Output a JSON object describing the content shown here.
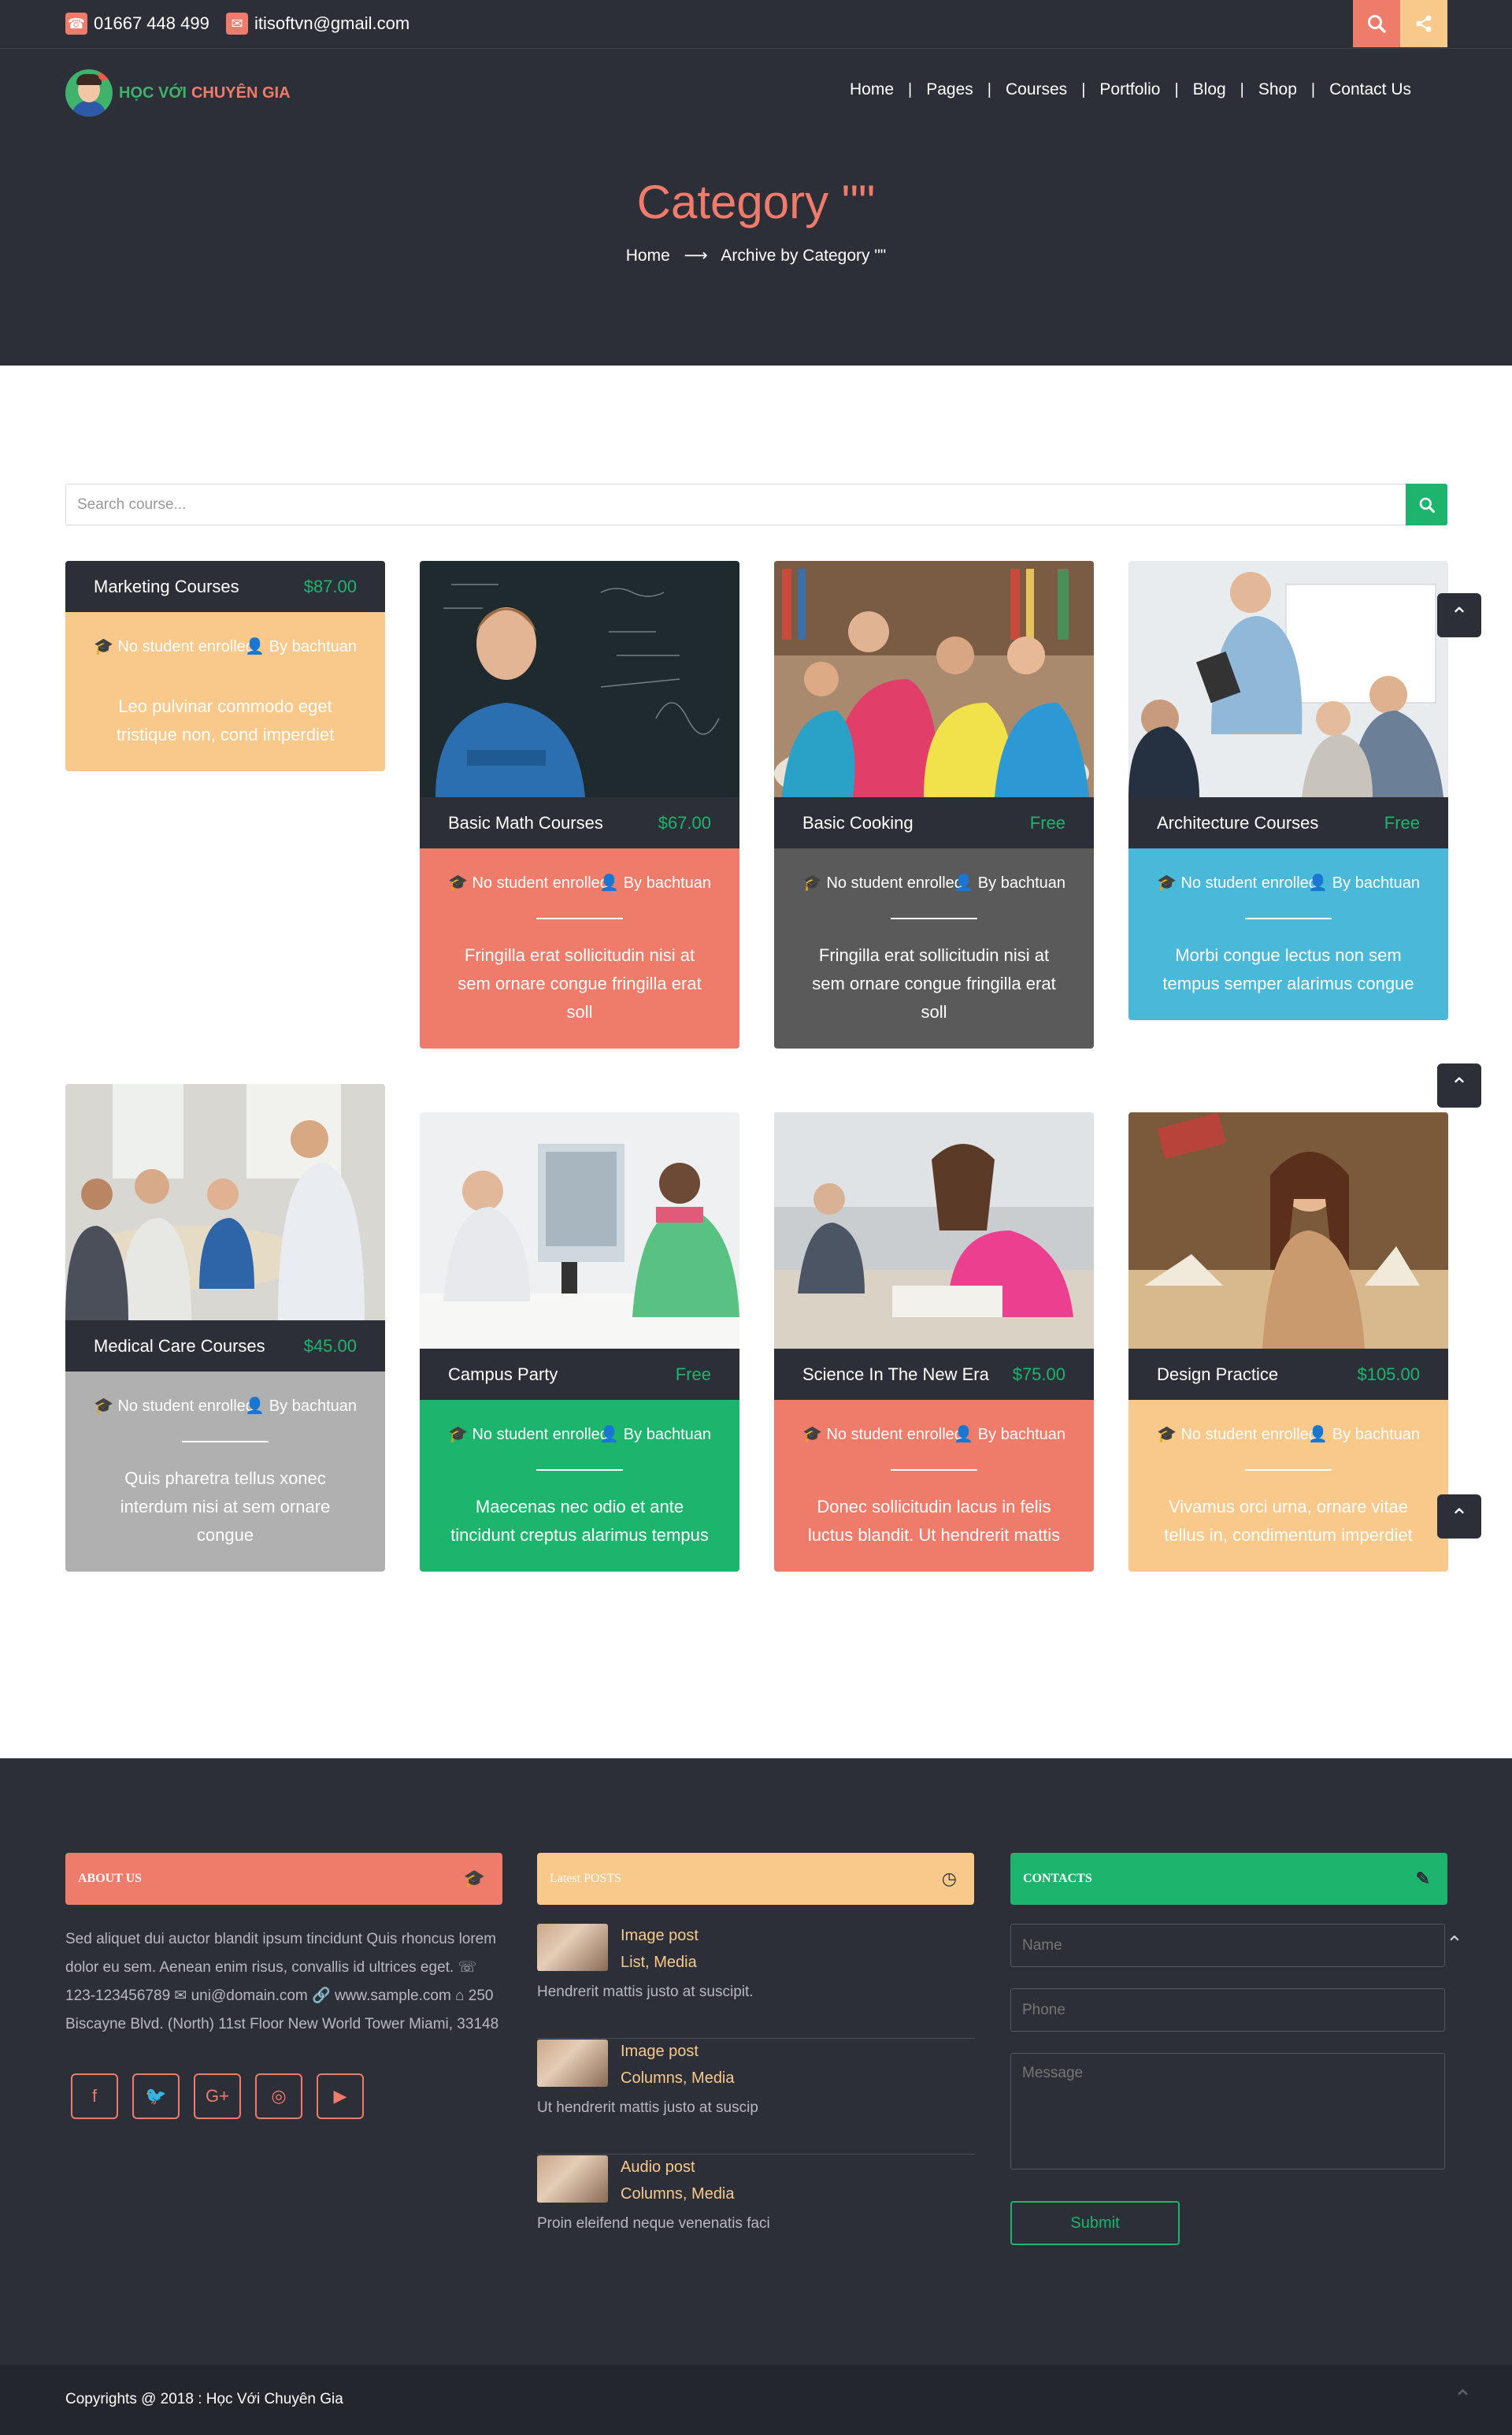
{
  "topbar": {
    "phone": "01667 448 499",
    "email": "itisoftvn@gmail.com",
    "phone_icon": "phone-icon",
    "email_icon": "envelope-icon",
    "search_icon": "search-icon",
    "share_icon": "share-icon",
    "search_color": "#ef7b6a",
    "share_color": "#f8c98a"
  },
  "header": {
    "logo_part1": "HỌC VỚI",
    "logo_part2": "CHUYÊN GIA",
    "nav": [
      "Home",
      "Pages",
      "Courses",
      "Portfolio",
      "Blog",
      "Shop",
      "Contact Us"
    ]
  },
  "hero": {
    "title": "Category \"\"",
    "crumb_home": "Home",
    "crumb_arrow": "⟶",
    "crumb_current": "Archive by Category \"\""
  },
  "search": {
    "placeholder": "Search course..."
  },
  "courses": [
    {
      "title": "Marketing Courses",
      "price": "$87.00",
      "students": "No student enrolled",
      "author": "By bachtuan",
      "desc": "Leo pulvinar commodo eget tristique non, cond imperdiet",
      "color": "#f8c98a",
      "has_image": false
    },
    {
      "title": "Basic Math Courses",
      "price": "$67.00",
      "students": "No student enrolled",
      "author": "By bachtuan",
      "desc": "Fringilla erat sollicitudin nisi at sem ornare congue fringilla erat soll",
      "color": "#ef7b6a",
      "has_image": true
    },
    {
      "title": "Basic Cooking",
      "price": "Free",
      "students": "No student enrolled",
      "author": "By bachtuan",
      "desc": "Fringilla erat sollicitudin nisi at sem ornare congue fringilla erat soll",
      "color": "#5a5a5a",
      "has_image": true
    },
    {
      "title": "Architecture Courses",
      "price": "Free",
      "students": "No student enrolled",
      "author": "By bachtuan",
      "desc": "Morbi congue lectus non sem tempus semper alarimus congue",
      "color": "#4ab9d9",
      "has_image": true
    },
    {
      "title": "Medical Care Courses",
      "price": "$45.00",
      "students": "No student enrolled",
      "author": "By bachtuan",
      "desc": "Quis pharetra tellus xonec interdum nisi at sem ornare congue",
      "color": "#b0b0b0",
      "has_image": true
    },
    {
      "title": "Campus Party",
      "price": "Free",
      "students": "No student enrolled",
      "author": "By bachtuan",
      "desc": "Maecenas nec odio et ante tincidunt creptus alarimus tempus",
      "color": "#1db56d",
      "has_image": true
    },
    {
      "title": "Science In The New Era",
      "price": "$75.00",
      "students": "No student enrolled",
      "author": "By bachtuan",
      "desc": "Donec sollicitudin lacus in felis luctus blandit. Ut hendrerit mattis",
      "color": "#ef7b6a",
      "has_image": true
    },
    {
      "title": "Design Practice",
      "price": "$105.00",
      "students": "No student enrolled",
      "author": "By bachtuan",
      "desc": "Vivamus orci urna, ornare vitae tellus in, condimentum imperdiet",
      "color": "#f8c98a",
      "has_image": true
    }
  ],
  "footer": {
    "about": {
      "heading": "ABOUT US",
      "icon": "graduation-cap-icon",
      "color": "#ef7b6a",
      "text": "Sed aliquet dui auctor blandit ipsum tincidunt Quis rhoncus lorem dolor eu sem. Aenean enim risus, convallis id ultrices eget. ☏ 123-123456789 ✉ uni@domain.com 🔗 www.sample.com ⌂ 250 Biscayne Blvd. (North) 11st Floor New World Tower Miami, 33148",
      "social": [
        "facebook-icon",
        "twitter-icon",
        "google-plus-icon",
        "dribbble-icon",
        "youtube-icon"
      ]
    },
    "latest": {
      "heading": "Latest POSTS",
      "icon": "clock-icon",
      "color": "#f8c98a",
      "posts": [
        {
          "title": "Image post",
          "cats": "List, Media",
          "excerpt": "Hendrerit mattis justo at suscipit."
        },
        {
          "title": "Image post",
          "cats": "Columns, Media",
          "excerpt": "Ut hendrerit mattis justo at suscip"
        },
        {
          "title": "Audio post",
          "cats": "Columns, Media",
          "excerpt": "Proin eleifend neque venenatis faci"
        }
      ]
    },
    "contacts": {
      "heading": "CONTACTS",
      "icon": "edit-icon",
      "color": "#1db56d",
      "name_placeholder": "Name",
      "phone_placeholder": "Phone",
      "message_placeholder": "Message",
      "submit": "Submit"
    },
    "copyright": "Copyrights @ 2018 : Học Với Chuyên Gia"
  }
}
